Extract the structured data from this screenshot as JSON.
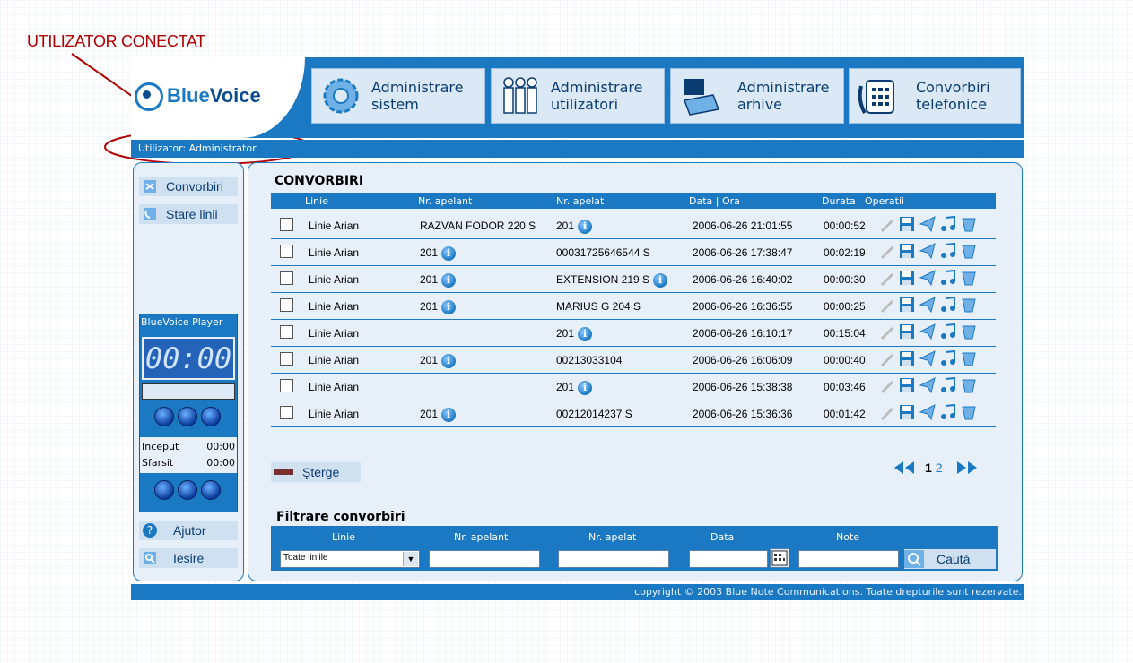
{
  "annotation": {
    "label": "UTILIZATOR CONECTAT"
  },
  "app": {
    "logo_text_a": "Blue",
    "logo_text_b": "Voice",
    "nav": [
      {
        "line1": "Administrare",
        "line2": "sistem",
        "icon": "gear-icon"
      },
      {
        "line1": "Administrare",
        "line2": "utilizatori",
        "icon": "users-icon"
      },
      {
        "line1": "Administrare",
        "line2": "arhive",
        "icon": "archive-icon"
      },
      {
        "line1": "Convorbiri",
        "line2": "telefonice",
        "icon": "phone-icon"
      }
    ],
    "user_label": "Utilizator: Administrator"
  },
  "sidebar": {
    "items": [
      {
        "label": "Convorbiri",
        "icon": "calls-icon"
      },
      {
        "label": "Stare linii",
        "icon": "lines-icon"
      }
    ],
    "player": {
      "title": "BlueVoice Player",
      "time": "00:00",
      "start_label": "Inceput",
      "start_value": "00:00",
      "end_label": "Sfarsit",
      "end_value": "00:00"
    },
    "bottom": [
      {
        "label": "Ajutor",
        "icon": "help-icon"
      },
      {
        "label": "Iesire",
        "icon": "exit-icon"
      }
    ]
  },
  "calls": {
    "title": "CONVORBIRI",
    "columns": [
      "Linie",
      "Nr. apelant",
      "Nr. apelat",
      "Data | Ora",
      "Durata",
      "Operatii"
    ],
    "rows": [
      {
        "linie": "Linie Arian",
        "apelant": "RAZVAN FODOR 220 S",
        "apelant_info": false,
        "apelat": "201",
        "apelat_info": true,
        "data": "2006-06-26 21:01:55",
        "durata": "00:00:52"
      },
      {
        "linie": "Linie Arian",
        "apelant": "201",
        "apelant_info": true,
        "apelat": "00031725646544 S",
        "apelat_info": false,
        "data": "2006-06-26 17:38:47",
        "durata": "00:02:19"
      },
      {
        "linie": "Linie Arian",
        "apelant": "201",
        "apelant_info": true,
        "apelat": "EXTENSION 219 S",
        "apelat_info": true,
        "data": "2006-06-26 16:40:02",
        "durata": "00:00:30"
      },
      {
        "linie": "Linie Arian",
        "apelant": "201",
        "apelant_info": true,
        "apelat": "MARIUS G 204 S",
        "apelat_info": false,
        "data": "2006-06-26 16:36:55",
        "durata": "00:00:25"
      },
      {
        "linie": "Linie Arian",
        "apelant": "",
        "apelant_info": false,
        "apelat": "201",
        "apelat_info": true,
        "data": "2006-06-26 16:10:17",
        "durata": "00:15:04"
      },
      {
        "linie": "Linie Arian",
        "apelant": "201",
        "apelant_info": true,
        "apelat": "00213033104",
        "apelat_info": false,
        "data": "2006-06-26 16:06:09",
        "durata": "00:00:40"
      },
      {
        "linie": "Linie Arian",
        "apelant": "",
        "apelant_info": false,
        "apelat": "201",
        "apelat_info": true,
        "data": "2006-06-26 15:38:38",
        "durata": "00:03:46"
      },
      {
        "linie": "Linie Arian",
        "apelant": "201",
        "apelant_info": true,
        "apelat": "00212014237 S",
        "apelat_info": false,
        "data": "2006-06-26 15:36:36",
        "durata": "00:01:42"
      }
    ],
    "delete_label": "Şterge",
    "pages": [
      "1",
      "2"
    ],
    "current_page": "1"
  },
  "filter": {
    "title": "Filtrare convorbiri",
    "labels": [
      "Linie",
      "Nr. apelant",
      "Nr. apelat",
      "Data",
      "Note"
    ],
    "line_select": "Toate liniile",
    "search_label": "Caută"
  },
  "footer": {
    "copyright": "copyright © 2003 Blue Note Communications. Toate drepturile sunt rezervate."
  },
  "colors": {
    "primary": "#1b78c2",
    "panel": "#e7f0f9",
    "annotation": "#b00000"
  }
}
